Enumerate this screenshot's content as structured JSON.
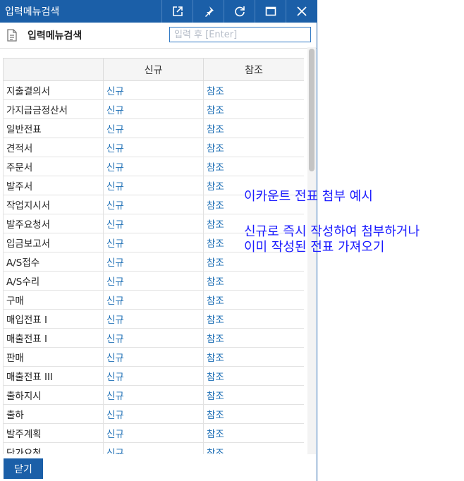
{
  "window": {
    "title": "입력메뉴검색"
  },
  "titlebar_icons": [
    "external-link-icon",
    "pin-icon",
    "refresh-icon",
    "maximize-icon",
    "close-icon"
  ],
  "toolbar": {
    "icon": "document-icon",
    "title": "입력메뉴검색",
    "search_placeholder": "입력 후 [Enter]",
    "search_value": ""
  },
  "grid": {
    "columns": [
      "",
      "신규",
      "참조"
    ],
    "rows": [
      {
        "name": "지출결의서",
        "new": "신규",
        "ref": "참조"
      },
      {
        "name": "가지급금정산서",
        "new": "신규",
        "ref": "참조"
      },
      {
        "name": "일반전표",
        "new": "신규",
        "ref": "참조"
      },
      {
        "name": "견적서",
        "new": "신규",
        "ref": "참조"
      },
      {
        "name": "주문서",
        "new": "신규",
        "ref": "참조"
      },
      {
        "name": "발주서",
        "new": "신규",
        "ref": "참조"
      },
      {
        "name": "작업지시서",
        "new": "신규",
        "ref": "참조"
      },
      {
        "name": "발주요청서",
        "new": "신규",
        "ref": "참조"
      },
      {
        "name": "입금보고서",
        "new": "신규",
        "ref": "참조"
      },
      {
        "name": "A/S접수",
        "new": "신규",
        "ref": "참조"
      },
      {
        "name": "A/S수리",
        "new": "신규",
        "ref": "참조"
      },
      {
        "name": "구매",
        "new": "신규",
        "ref": "참조"
      },
      {
        "name": "매입전표 I",
        "new": "신규",
        "ref": "참조"
      },
      {
        "name": "매출전표 I",
        "new": "신규",
        "ref": "참조"
      },
      {
        "name": "판매",
        "new": "신규",
        "ref": "참조"
      },
      {
        "name": "매출전표 III",
        "new": "신규",
        "ref": "참조"
      },
      {
        "name": "출하지시",
        "new": "신규",
        "ref": "참조"
      },
      {
        "name": "출하",
        "new": "신규",
        "ref": "참조"
      },
      {
        "name": "발주계획",
        "new": "신규",
        "ref": "참조"
      },
      {
        "name": "단가요청",
        "new": "신규",
        "ref": "참조"
      }
    ]
  },
  "footer": {
    "close_label": "닫기"
  },
  "annotations": {
    "line1": "이카운트 전표 첨부 예시",
    "line2": "신규로 즉시 작성하여 첨부하거나",
    "line3": "이미 작성된 전표 가져오기"
  },
  "colors": {
    "accent": "#1b5fa8",
    "link": "#1b6db4",
    "annotation": "#1a1aff"
  }
}
